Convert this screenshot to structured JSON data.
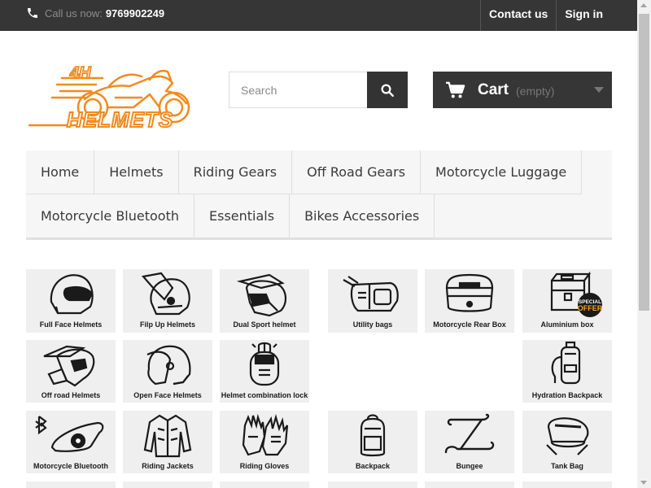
{
  "topbar": {
    "call_label": "Call us now:",
    "phone_number": "9769902249",
    "contact_label": "Contact us",
    "signin_label": "Sign in"
  },
  "logo": {
    "line1": "4H",
    "line2": "HELMETS",
    "color": "#f28a1e"
  },
  "search": {
    "placeholder": "Search"
  },
  "cart": {
    "label": "Cart",
    "status": "(empty)"
  },
  "menu": {
    "row1": [
      "Home",
      "Helmets",
      "Riding Gears",
      "Off Road Gears",
      "Motorcycle Luggage"
    ],
    "row2": [
      "Motorcycle Bluetooth",
      "Essentials",
      "Bikes Accessories"
    ]
  },
  "tiles": [
    "Full Face Helmets",
    "Filp Up Helmets",
    "Dual Sport helmet",
    "Utility bags",
    "Motorcycle Rear Box",
    "Aluminium box",
    "Off road Helmets",
    "Open Face Helmets",
    "Helmet combination lock",
    "Hydration Backpack",
    "Motorcycle Bluetooth",
    "Riding Jackets",
    "Riding Gloves",
    "Backpack",
    "Bungee",
    "Tank Bag"
  ],
  "badge": {
    "line1": "SPECIAL",
    "line2": "OFFER"
  }
}
